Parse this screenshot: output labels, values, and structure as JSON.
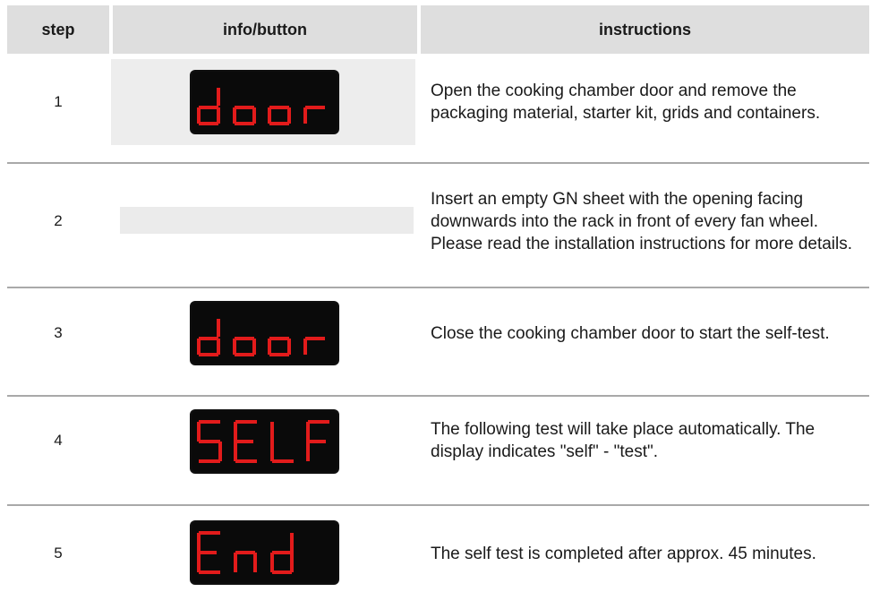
{
  "colors": {
    "header_bg": "#dedede",
    "info_bg": "#ededed",
    "display_bg": "#0a0a0a",
    "display_digit": "#e21b1b",
    "divider": "#a9a9a9"
  },
  "header": {
    "step": "step",
    "info": "info/button",
    "instructions": "instructions"
  },
  "rows": [
    {
      "step": "1",
      "display": "door",
      "instructions": "Open the cooking chamber door and remove the packaging material, starter kit, grids and containers."
    },
    {
      "step": "2",
      "display": "",
      "instructions": "Insert an empty GN sheet with the opening facing downwards into the rack in front of every fan wheel. Please read the installation instructions for more details."
    },
    {
      "step": "3",
      "display": "door",
      "instructions": "Close the cooking chamber door to start the self-test."
    },
    {
      "step": "4",
      "display": "SELF",
      "instructions": "The following test will take place automatically. The display indicates \"self\" - \"test\"."
    },
    {
      "step": "5",
      "display": "End",
      "instructions": "The self test is completed after approx. 45 minutes."
    }
  ]
}
